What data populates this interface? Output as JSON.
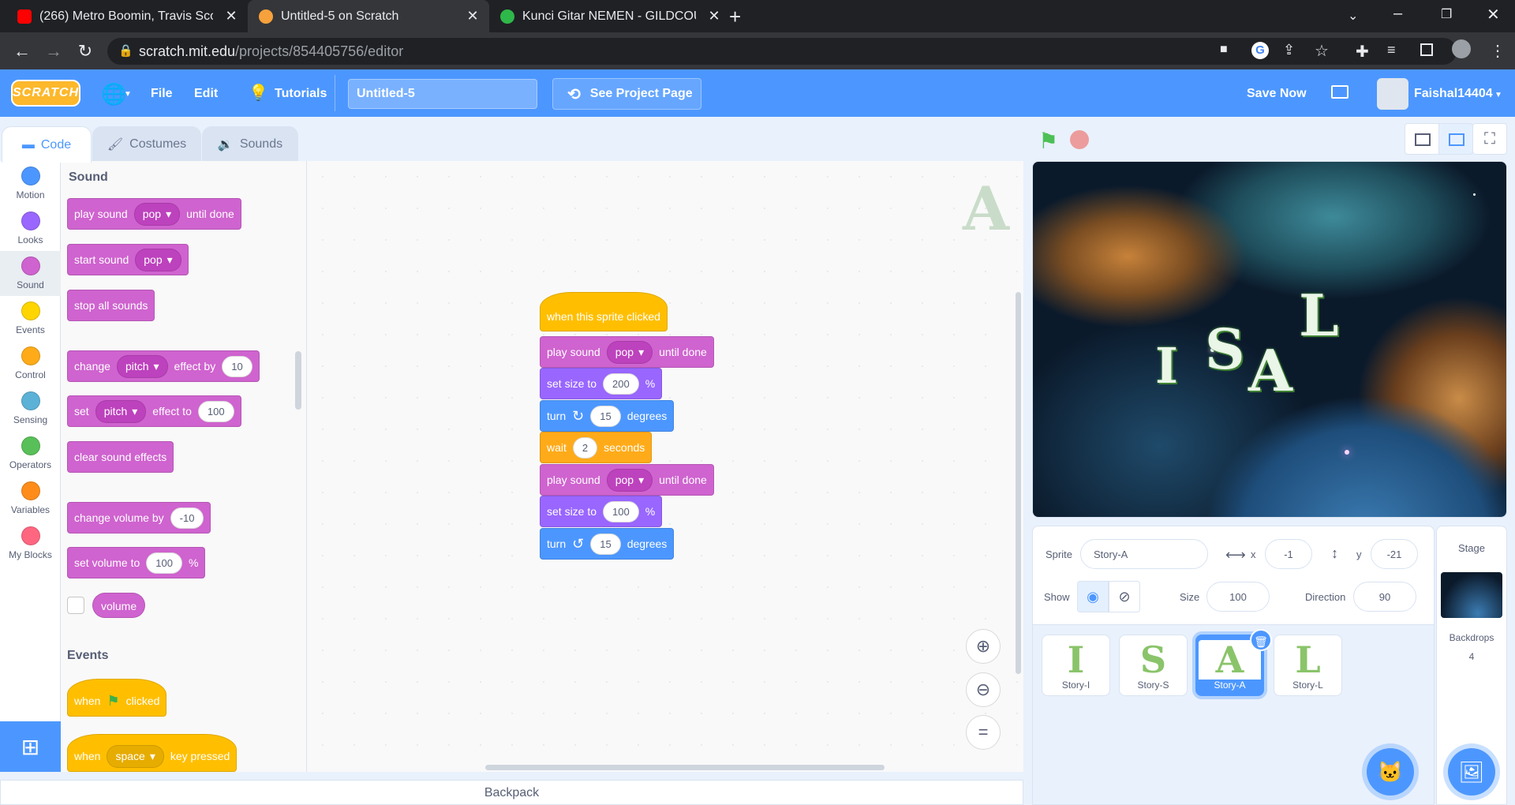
{
  "browser": {
    "tabs": [
      {
        "title": "(266) Metro Boomin, Travis Scott,",
        "favicon_color": "#ff0000"
      },
      {
        "title": "Untitled-5 on Scratch",
        "favicon_color": "#f7a13c",
        "active": true
      },
      {
        "title": "Kunci Gitar NEMEN - GILDCOUST",
        "favicon_color": "#2fb84a"
      }
    ],
    "url_host": "scratch.mit.edu",
    "url_path": "/projects/854405756/editor"
  },
  "menu": {
    "logo": "SCRATCH",
    "file": "File",
    "edit": "Edit",
    "tutorials": "Tutorials",
    "project_title": "Untitled-5",
    "see_project": "See Project Page",
    "save_now": "Save Now",
    "username": "Faishal14404"
  },
  "editor_tabs": {
    "code": "Code",
    "costumes": "Costumes",
    "sounds": "Sounds"
  },
  "categories": [
    {
      "label": "Motion",
      "color": "#4c97ff"
    },
    {
      "label": "Looks",
      "color": "#9966ff"
    },
    {
      "label": "Sound",
      "color": "#cf63cf"
    },
    {
      "label": "Events",
      "color": "#ffd500"
    },
    {
      "label": "Control",
      "color": "#ffab19"
    },
    {
      "label": "Sensing",
      "color": "#5cb1d6"
    },
    {
      "label": "Operators",
      "color": "#59c059"
    },
    {
      "label": "Variables",
      "color": "#ff8c1a"
    },
    {
      "label": "My Blocks",
      "color": "#ff6680"
    }
  ],
  "palette": {
    "sound_heading": "Sound",
    "play_sound": "play sound",
    "until_done": "until done",
    "pop": "pop",
    "start_sound": "start sound",
    "stop_all": "stop all sounds",
    "change": "change",
    "pitch": "pitch",
    "effect_by": "effect by",
    "val10": "10",
    "set": "set",
    "effect_to": "effect to",
    "val100": "100",
    "clear_effects": "clear sound effects",
    "change_volume": "change volume by",
    "valm10": "-10",
    "set_volume": "set volume to",
    "percent": "%",
    "volume": "volume",
    "events_heading": "Events",
    "when": "when",
    "clicked": "clicked",
    "space": "space",
    "key_pressed": "key pressed"
  },
  "script": {
    "hat": "when this sprite clicked",
    "play_sound": "play sound",
    "pop": "pop",
    "until_done": "until done",
    "set_size": "set size to",
    "size1": "200",
    "percent": "%",
    "turn": "turn",
    "deg1": "15",
    "degrees": "degrees",
    "wait": "wait",
    "wait_val": "2",
    "seconds": "seconds",
    "size2": "100",
    "deg2": "15"
  },
  "workspace_sprite_letter": "A",
  "backpack": "Backpack",
  "stage_letters": [
    "I",
    "S",
    "A",
    "L"
  ],
  "sprite_info": {
    "sprite_label": "Sprite",
    "sprite_name": "Story-A",
    "x_label": "x",
    "x": "-1",
    "y_label": "y",
    "y": "-21",
    "show_label": "Show",
    "size_label": "Size",
    "size": "100",
    "direction_label": "Direction",
    "direction": "90"
  },
  "sprites": [
    {
      "glyph": "I",
      "name": "Story-I"
    },
    {
      "glyph": "S",
      "name": "Story-S"
    },
    {
      "glyph": "A",
      "name": "Story-A",
      "selected": true
    },
    {
      "glyph": "L",
      "name": "Story-L"
    }
  ],
  "stage_panel": {
    "title": "Stage",
    "backdrops_label": "Backdrops",
    "backdrops_count": "4"
  }
}
